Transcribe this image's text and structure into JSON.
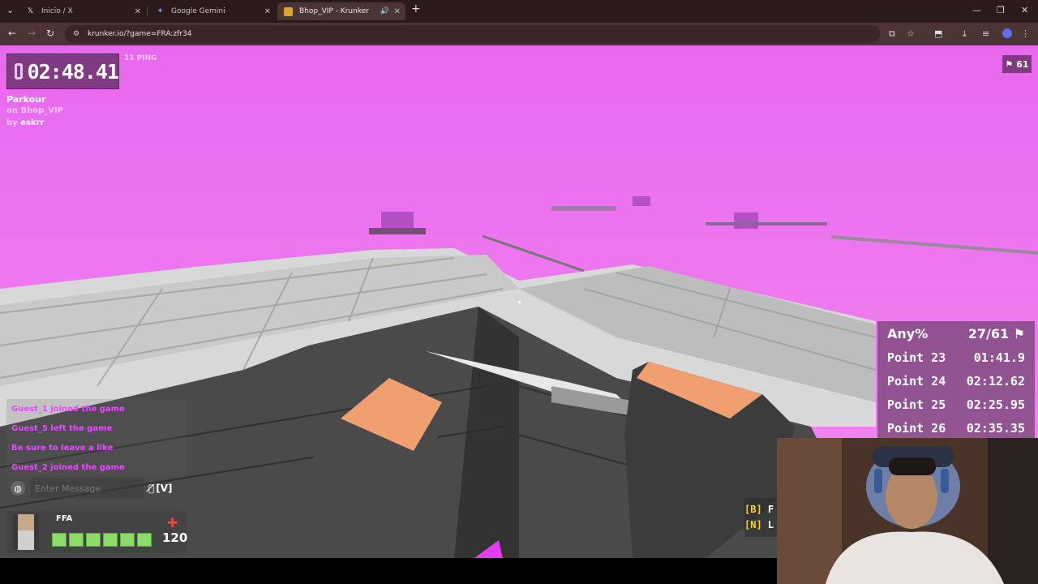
{
  "browser": {
    "tabs": [
      {
        "title": "Inicio / X",
        "icon": "x-logo-icon",
        "active": false
      },
      {
        "title": "Google Gemini",
        "icon": "gemini-icon",
        "active": false
      },
      {
        "title": "Bhop_VIP - Krunker",
        "icon": "krunker-icon",
        "active": true
      }
    ],
    "new_tab": "+",
    "url": "krunker.io/?game=FRA:zfr34"
  },
  "hud": {
    "timer": "02:48.41",
    "ping": "11 PING",
    "mode": "Parkour",
    "map_line": "on Bhop_VIP",
    "author_prefix": "by",
    "author": "eskrr",
    "flag_count": "61"
  },
  "splits": {
    "category": "Any%",
    "progress": "27/61",
    "rows": [
      {
        "label": "Point 23",
        "time": "01:41.9"
      },
      {
        "label": "Point 24",
        "time": "02:12.62"
      },
      {
        "label": "Point 25",
        "time": "02:25.95"
      },
      {
        "label": "Point 26",
        "time": "02:35.35"
      }
    ]
  },
  "chat": {
    "messages": [
      "Guest_1 joined the game",
      "Guest_5 left the game",
      "Be sure to leave a like",
      "Guest_2 joined the game"
    ],
    "input_placeholder": "Enter Message",
    "mute_hint": "[V]"
  },
  "player": {
    "team": "FFA",
    "health": "120",
    "health_fraction": 1.0,
    "health_segments": 6
  },
  "keyhints": [
    {
      "key": "[B]",
      "text": "F"
    },
    {
      "key": "[N]",
      "text": "L"
    }
  ],
  "colors": {
    "sky": "#ec6ef0",
    "chat_text": "#e24cff",
    "health": "#8cdc6a"
  }
}
